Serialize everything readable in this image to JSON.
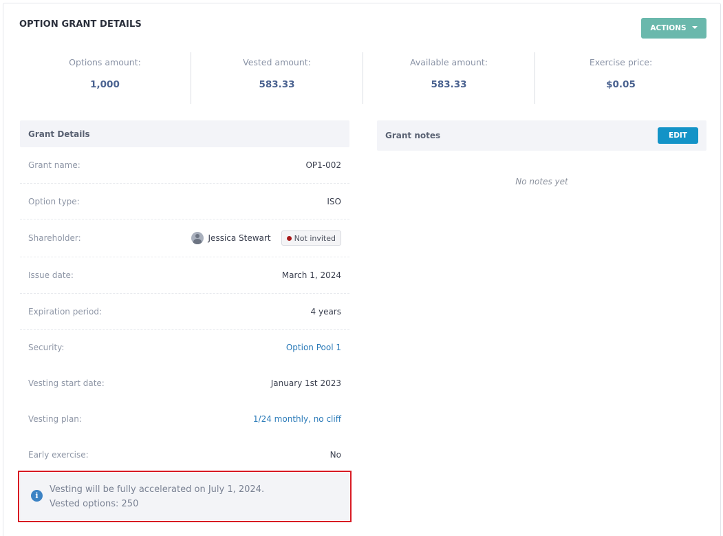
{
  "header": {
    "title": "OPTION GRANT DETAILS",
    "actions_label": "ACTIONS"
  },
  "stats": [
    {
      "label": "Options amount:",
      "value": "1,000"
    },
    {
      "label": "Vested amount:",
      "value": "583.33"
    },
    {
      "label": "Available amount:",
      "value": "583.33"
    },
    {
      "label": "Exercise price:",
      "value": "$0.05"
    }
  ],
  "grant_details": {
    "title": "Grant Details",
    "rows": [
      {
        "label": "Grant name:",
        "value": "OP1-002"
      },
      {
        "label": "Option type:",
        "value": "ISO"
      },
      {
        "label": "Shareholder:",
        "value": "Jessica Stewart",
        "badge": "Not invited",
        "badge_color": "#a81a1a"
      },
      {
        "label": "Issue date:",
        "value": "March 1, 2024"
      },
      {
        "label": "Expiration period:",
        "value": "4 years"
      },
      {
        "label": "Security:",
        "value": "Option Pool 1"
      },
      {
        "label": "Vesting start date:",
        "value": "January 1st 2023"
      },
      {
        "label": "Vesting plan:",
        "value": "1/24 monthly, no cliff"
      },
      {
        "label": "Early exercise:",
        "value": "No"
      }
    ]
  },
  "alert": {
    "icon": "info-icon",
    "line1": "Vesting will be fully accelerated on July 1, 2024.",
    "line2": "Vested options: 250"
  },
  "notes": {
    "title": "Grant notes",
    "edit_label": "EDIT",
    "empty_text": "No notes yet"
  },
  "colors": {
    "accent_actions": "#6ab8ac",
    "accent_edit": "#1393c7",
    "link": "#2a7ab8",
    "highlight_border": "#d81a23"
  }
}
